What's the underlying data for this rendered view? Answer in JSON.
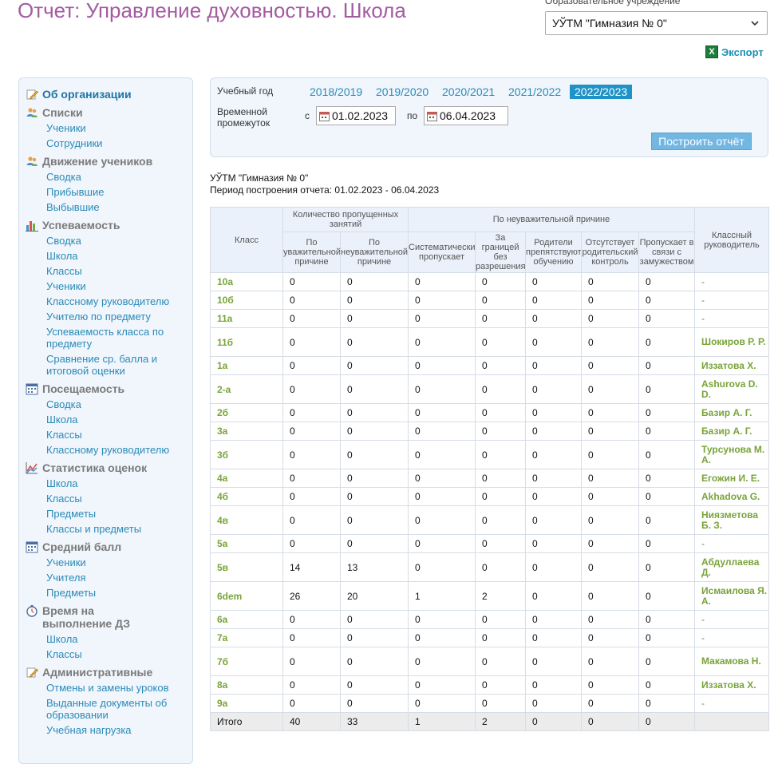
{
  "header": {
    "title": "Отчет: Управление духовностью. Школа",
    "org_label": "Образовательное учреждение",
    "org_selected": "УЎТМ \"Гимназия № 0\"",
    "export_label": "Экспорт"
  },
  "sidebar": {
    "sections": [
      {
        "title": "Об организации",
        "icon": "pencil-icon",
        "items": []
      },
      {
        "title": "Списки",
        "icon": "users-icon",
        "items": [
          "Ученики",
          "Сотрудники"
        ]
      },
      {
        "title": "Движение учеников",
        "icon": "users-icon",
        "items": [
          "Сводка",
          "Прибывшие",
          "Выбывшие"
        ]
      },
      {
        "title": "Успеваемость",
        "icon": "bar-chart-icon",
        "items": [
          "Сводка",
          "Школа",
          "Классы",
          "Ученики",
          "Классному руководителю",
          "Учителю по предмету",
          "Успеваемость класса по предмету",
          "Сравнение ср. балла и итоговой оценки"
        ]
      },
      {
        "title": "Посещаемость",
        "icon": "calendar-icon",
        "items": [
          "Сводка",
          "Школа",
          "Классы",
          "Классному руководителю"
        ]
      },
      {
        "title": "Статистика оценок",
        "icon": "line-chart-icon",
        "items": [
          "Школа",
          "Классы",
          "Предметы",
          "Классы и предметы"
        ]
      },
      {
        "title": "Средний балл",
        "icon": "calendar-icon",
        "items": [
          "Ученики",
          "Учителя",
          "Предметы"
        ]
      },
      {
        "title": "Время на выполнение ДЗ",
        "icon": "stopwatch-icon",
        "items": [
          "Школа",
          "Классы"
        ]
      },
      {
        "title": "Административные",
        "icon": "pencil-icon",
        "items": [
          "Отмены и замены уроков",
          "Выданные документы об образовании",
          "Учебная нагрузка"
        ]
      }
    ]
  },
  "filter": {
    "year_label": "Учебный год",
    "years": [
      "2018/2019",
      "2019/2020",
      "2020/2021",
      "2021/2022",
      "2022/2023"
    ],
    "active_year": "2022/2023",
    "period_label": "Временной промежуток",
    "from_label": "с",
    "from_value": "01.02.2023",
    "to_label": "по",
    "to_value": "06.04.2023",
    "build_button": "Построить отчёт"
  },
  "info": {
    "org": "УЎТМ \"Гимназия № 0\"",
    "period": "Период построения отчета: 01.02.2023 - 06.04.2023"
  },
  "table": {
    "headers": {
      "class": "Класс",
      "missed": "Количество пропущенных занятий",
      "excused": "По уважительной причине",
      "unexcused": "По неуважительной причине",
      "group_unexcused": "По неуважительной причине",
      "systematic": "Систематически пропускает",
      "abroad": "За границей без разрешения",
      "parents": "Родители препятствуют обучению",
      "no_control": "Отсутствует родительский контроль",
      "marriage": "Пропускает в связи с замужеством",
      "teacher": "Классный руководитель"
    },
    "rows": [
      {
        "cls": "10а",
        "v": [
          "0",
          "0",
          "0",
          "0",
          "0",
          "0",
          "0"
        ],
        "teacher": "-"
      },
      {
        "cls": "10б",
        "v": [
          "0",
          "0",
          "0",
          "0",
          "0",
          "0",
          "0"
        ],
        "teacher": "-"
      },
      {
        "cls": "11а",
        "v": [
          "0",
          "0",
          "0",
          "0",
          "0",
          "0",
          "0"
        ],
        "teacher": "-"
      },
      {
        "cls": "11б",
        "v": [
          "0",
          "0",
          "0",
          "0",
          "0",
          "0",
          "0"
        ],
        "teacher": "Шокиров Р. Р."
      },
      {
        "cls": "1а",
        "v": [
          "0",
          "0",
          "0",
          "0",
          "0",
          "0",
          "0"
        ],
        "teacher": "Иззатова Х."
      },
      {
        "cls": "2-а",
        "v": [
          "0",
          "0",
          "0",
          "0",
          "0",
          "0",
          "0"
        ],
        "teacher": "Ashurova D. D."
      },
      {
        "cls": "2б",
        "v": [
          "0",
          "0",
          "0",
          "0",
          "0",
          "0",
          "0"
        ],
        "teacher": "Базир А. Г."
      },
      {
        "cls": "3а",
        "v": [
          "0",
          "0",
          "0",
          "0",
          "0",
          "0",
          "0"
        ],
        "teacher": "Базир А. Г."
      },
      {
        "cls": "3б",
        "v": [
          "0",
          "0",
          "0",
          "0",
          "0",
          "0",
          "0"
        ],
        "teacher": "Турсунова М. А."
      },
      {
        "cls": "4а",
        "v": [
          "0",
          "0",
          "0",
          "0",
          "0",
          "0",
          "0"
        ],
        "teacher": "Егожин И. Е."
      },
      {
        "cls": "4б",
        "v": [
          "0",
          "0",
          "0",
          "0",
          "0",
          "0",
          "0"
        ],
        "teacher": "Akhadova G."
      },
      {
        "cls": "4в",
        "v": [
          "0",
          "0",
          "0",
          "0",
          "0",
          "0",
          "0"
        ],
        "teacher": "Ниязметова Б. З."
      },
      {
        "cls": "5а",
        "v": [
          "0",
          "0",
          "0",
          "0",
          "0",
          "0",
          "0"
        ],
        "teacher": "-"
      },
      {
        "cls": "5в",
        "v": [
          "14",
          "13",
          "0",
          "0",
          "0",
          "0",
          "0"
        ],
        "teacher": "Абдуллаева Д."
      },
      {
        "cls": "6dem",
        "v": [
          "26",
          "20",
          "1",
          "2",
          "0",
          "0",
          "0"
        ],
        "teacher": "Исмаилова Я. А."
      },
      {
        "cls": "6а",
        "v": [
          "0",
          "0",
          "0",
          "0",
          "0",
          "0",
          "0"
        ],
        "teacher": "-"
      },
      {
        "cls": "7а",
        "v": [
          "0",
          "0",
          "0",
          "0",
          "0",
          "0",
          "0"
        ],
        "teacher": "-"
      },
      {
        "cls": "7б",
        "v": [
          "0",
          "0",
          "0",
          "0",
          "0",
          "0",
          "0"
        ],
        "teacher": "Макамова Н."
      },
      {
        "cls": "8а",
        "v": [
          "0",
          "0",
          "0",
          "0",
          "0",
          "0",
          "0"
        ],
        "teacher": "Иззатова Х."
      },
      {
        "cls": "9а",
        "v": [
          "0",
          "0",
          "0",
          "0",
          "0",
          "0",
          "0"
        ],
        "teacher": "-"
      }
    ],
    "total": {
      "label": "Итого",
      "v": [
        "40",
        "33",
        "1",
        "2",
        "0",
        "0",
        "0"
      ]
    }
  }
}
